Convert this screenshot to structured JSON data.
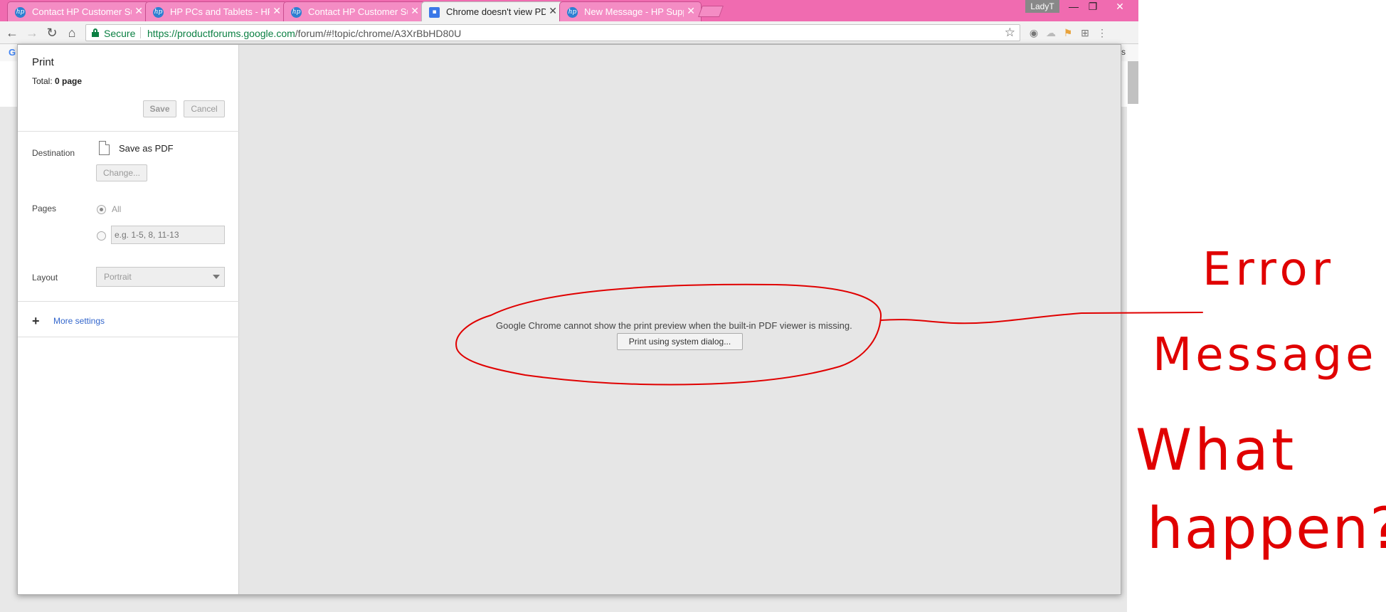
{
  "colors": {
    "tabstrip": "#f06bb0",
    "secure_green": "#0b8043",
    "annotation_red": "#e00000",
    "link_blue": "#3366cc"
  },
  "tabs": [
    {
      "title": "Contact HP Customer Su",
      "icon": "hp-logo-icon",
      "active": false
    },
    {
      "title": "HP PCs and Tablets - HP",
      "icon": "hp-logo-icon",
      "active": false
    },
    {
      "title": "Contact HP Customer Su",
      "icon": "hp-logo-icon",
      "active": false
    },
    {
      "title": "Chrome doesn't view PD",
      "icon": "google-forum-icon",
      "active": true
    },
    {
      "title": "New Message - HP Supp",
      "icon": "hp-logo-icon",
      "active": false
    }
  ],
  "window": {
    "profile": "LadyT",
    "minimize": "—",
    "maximize": "❐",
    "close": "✕"
  },
  "omnibox": {
    "secure_label": "Secure",
    "url_host": "https://productforums.google.com",
    "url_path": "/forum/#!topic/chrome/A3XrBbHD80U"
  },
  "page_behind": {
    "bookmark_letter": "G",
    "bookmarks_tail": "ks"
  },
  "print": {
    "title": "Print",
    "total_prefix": "Total: ",
    "total_value": "0 page",
    "save_label": "Save",
    "cancel_label": "Cancel",
    "destination_label": "Destination",
    "destination_value": "Save as PDF",
    "change_label": "Change...",
    "pages_label": "Pages",
    "pages_all": "All",
    "pages_placeholder": "e.g. 1-5, 8, 11-13",
    "layout_label": "Layout",
    "layout_value": "Portrait",
    "more_settings": "More settings"
  },
  "preview": {
    "message": "Google Chrome cannot show the print preview when the built-in PDF viewer is missing.",
    "system_dialog_button": "Print using system dialog..."
  },
  "annotation": {
    "line1": "Error",
    "line2": "Message",
    "line3": "What",
    "line4": "happen?"
  }
}
